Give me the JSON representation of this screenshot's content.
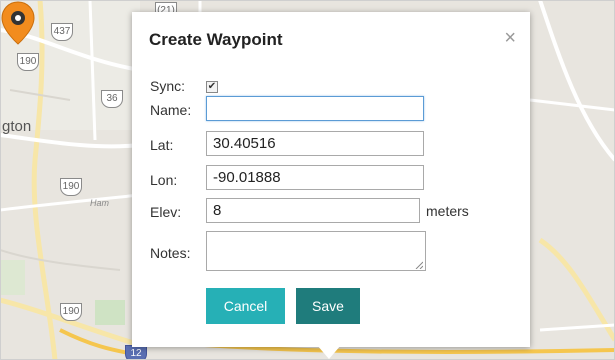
{
  "map": {
    "route_shields": [
      "(21)",
      "437",
      "190",
      "36",
      "190",
      "190",
      "12"
    ],
    "place_labels": {
      "city_partial": "gton",
      "street_partial": "Ham"
    }
  },
  "dialog": {
    "title": "Create Waypoint",
    "close_symbol": "×",
    "sync_label": "Sync:",
    "sync_checked": true,
    "name_label": "Name:",
    "name_value": "",
    "lat_label": "Lat:",
    "lat_value": "30.40516",
    "lon_label": "Lon:",
    "lon_value": "-90.01888",
    "elev_label": "Elev:",
    "elev_value": "8",
    "elev_units": "meters",
    "notes_label": "Notes:",
    "notes_value": "",
    "cancel_label": "Cancel",
    "save_label": "Save"
  },
  "colors": {
    "cancel_button": "#26b0b6",
    "save_button": "#1f7c7c",
    "pin": "#f28c1e"
  },
  "icons": {
    "pin": "map-pin-icon",
    "close": "close-icon",
    "check": "checkmark-icon"
  }
}
